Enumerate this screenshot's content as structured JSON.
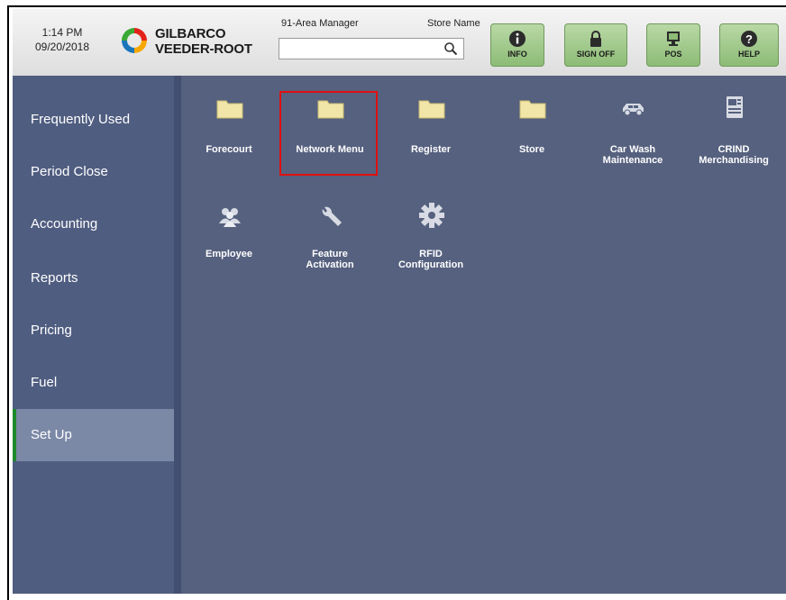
{
  "header": {
    "time": "1:14 PM",
    "date": "09/20/2018",
    "brand_line1": "GILBARCO",
    "brand_line2": "VEEDER-ROOT",
    "user": "91-Area Manager",
    "store": "Store Name",
    "search_value": "",
    "buttons": [
      {
        "label": "INFO",
        "icon": "info-icon"
      },
      {
        "label": "SIGN OFF",
        "icon": "lock-icon"
      },
      {
        "label": "POS",
        "icon": "monitor-icon"
      },
      {
        "label": "HELP",
        "icon": "help-icon"
      }
    ]
  },
  "sidebar": {
    "items": [
      {
        "label": "Frequently Used"
      },
      {
        "label": "Period Close"
      },
      {
        "label": "Accounting"
      },
      {
        "label": "Reports"
      },
      {
        "label": "Pricing"
      },
      {
        "label": "Fuel"
      },
      {
        "label": "Set Up",
        "active": true
      }
    ]
  },
  "main": {
    "tiles": [
      {
        "label": "Forecourt",
        "icon": "folder-icon"
      },
      {
        "label": "Network Menu",
        "icon": "folder-icon",
        "highlighted": true
      },
      {
        "label": "Register",
        "icon": "folder-icon"
      },
      {
        "label": "Store",
        "icon": "folder-icon"
      },
      {
        "label_line1": "Car Wash",
        "label_line2": "Maintenance",
        "icon": "car-icon"
      },
      {
        "label_line1": "CRIND",
        "label_line2": "Merchandising",
        "icon": "crind-icon"
      },
      {
        "label": "Employee",
        "icon": "people-icon"
      },
      {
        "label_line1": "Feature",
        "label_line2": "Activation",
        "icon": "wrench-icon"
      },
      {
        "label_line1": "RFID",
        "label_line2": "Configuration",
        "icon": "gear-icon"
      }
    ]
  },
  "colors": {
    "sidebar_bg": "#4f5d80",
    "main_bg": "#56617f",
    "active_item_bg": "#7b88a6",
    "active_marker": "#1d8a2a",
    "button_green": "#a3cb8d",
    "folder": "#f1e6a8",
    "highlight_border": "#e01010"
  }
}
